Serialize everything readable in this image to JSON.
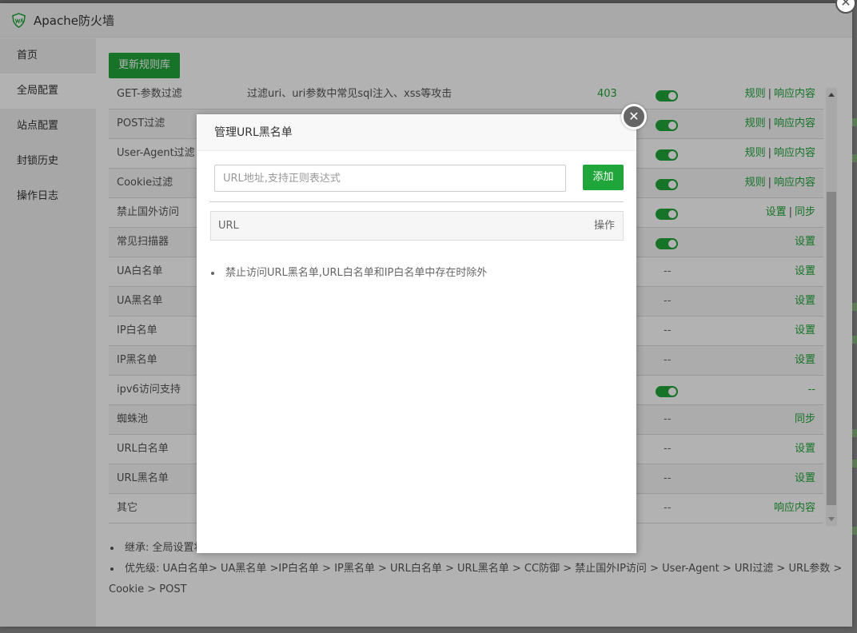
{
  "window": {
    "title": "Apache防火墙"
  },
  "sidebar": {
    "items": [
      {
        "label": "首页",
        "active": false
      },
      {
        "label": "全局配置",
        "active": true
      },
      {
        "label": "站点配置",
        "active": false
      },
      {
        "label": "封锁历史",
        "active": false
      },
      {
        "label": "操作日志",
        "active": false
      }
    ]
  },
  "toolbar": {
    "update_label": "更新规则库"
  },
  "rules": [
    {
      "name": "GET-参数过滤",
      "desc": "过滤uri、uri参数中常见sql注入、xss等攻击",
      "code": "403",
      "toggle": true,
      "actions": [
        "规则",
        "响应内容"
      ]
    },
    {
      "name": "POST过滤",
      "toggle": true,
      "actions": [
        "规则",
        "响应内容"
      ]
    },
    {
      "name": "User-Agent过滤",
      "toggle": true,
      "actions": [
        "规则",
        "响应内容"
      ]
    },
    {
      "name": "Cookie过滤",
      "toggle": true,
      "actions": [
        "规则",
        "响应内容"
      ]
    },
    {
      "name": "禁止国外访问",
      "toggle": true,
      "actions": [
        "设置",
        "同步"
      ]
    },
    {
      "name": "常见扫描器",
      "toggle": true,
      "actions": [
        "设置"
      ]
    },
    {
      "name": "UA白名单",
      "dash": "--",
      "actions": [
        "设置"
      ]
    },
    {
      "name": "UA黑名单",
      "dash": "--",
      "actions": [
        "设置"
      ]
    },
    {
      "name": "IP白名单",
      "dash": "--",
      "actions": [
        "设置"
      ]
    },
    {
      "name": "IP黑名单",
      "dash": "--",
      "actions": [
        "设置"
      ]
    },
    {
      "name": "ipv6访问支持",
      "toggle": true,
      "actions": [
        "--"
      ]
    },
    {
      "name": "蜘蛛池",
      "dash": "--",
      "actions": [
        "同步"
      ]
    },
    {
      "name": "URL白名单",
      "dash": "--",
      "actions": [
        "设置"
      ]
    },
    {
      "name": "URL黑名单",
      "dash": "--",
      "actions": [
        "设置"
      ]
    },
    {
      "name": "其它",
      "dash": "--",
      "actions": [
        "响应内容"
      ]
    }
  ],
  "notes": {
    "inherit": "继承: 全局设置将",
    "priority": "优先级: UA白名单> UA黑名单 >IP白名单 > IP黑名单 > URL白名单 > URL黑名单 > CC防御 > 禁止国外IP访问 > User-Agent > URI过滤 > URL参数 >",
    "priority_tail": "Cookie > POST"
  },
  "dialog": {
    "title": "管理URL黑名单",
    "close_glyph": "✕",
    "input_placeholder": "URL地址,支持正则表达式",
    "input_value": "",
    "add_label": "添加",
    "columns": {
      "url": "URL",
      "op": "操作"
    },
    "note": "禁止访问URL黑名单,URL白名单和IP白名单中存在时除外"
  },
  "outer_close_glyph": "✕",
  "colors": {
    "accent": "#20a53a",
    "mask": "rgba(0,0,0,0.3)",
    "sidebar_bg": "#f0f0f0"
  },
  "icons": {
    "app": "shield-waf-icon",
    "close": "close-icon"
  }
}
